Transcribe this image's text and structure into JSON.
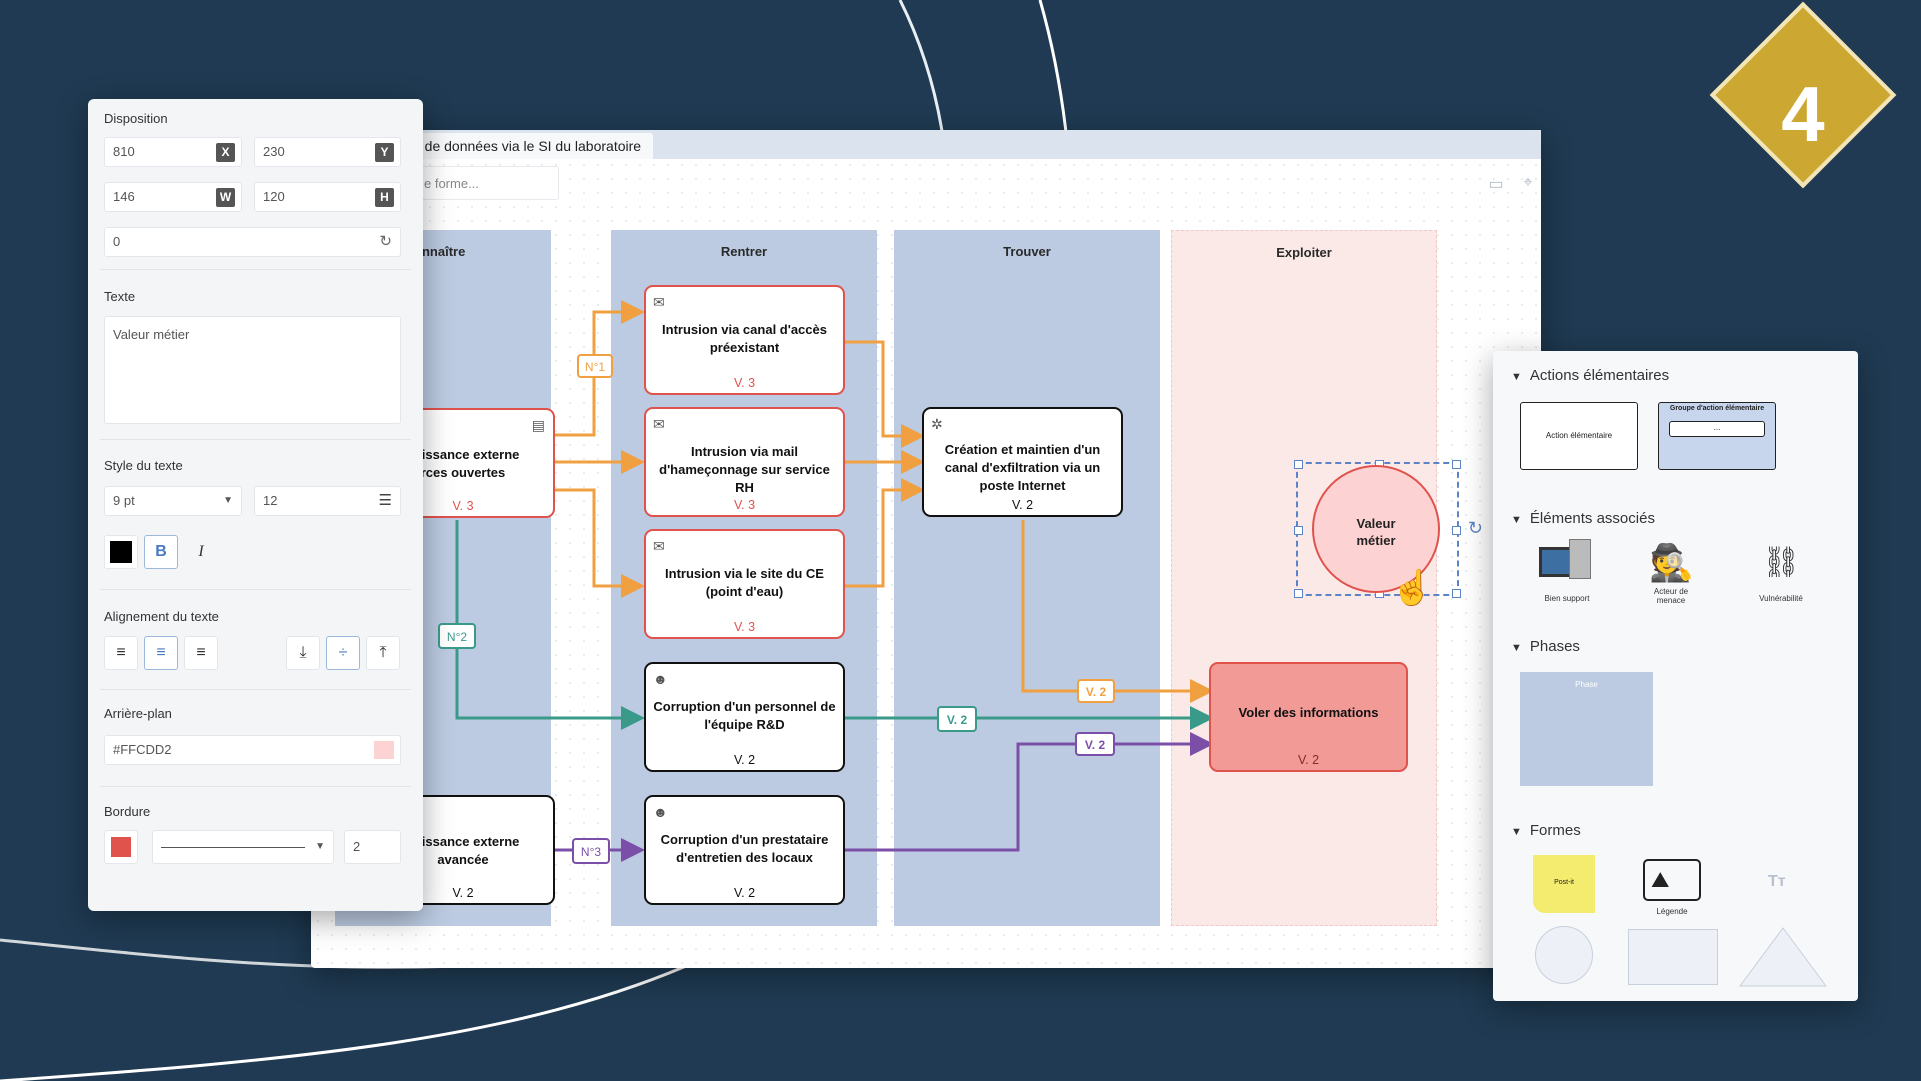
{
  "step_badge": "4",
  "tab": {
    "title": "n de données via le SI du laboratoire"
  },
  "search": {
    "placeholder": "e forme..."
  },
  "phases": [
    {
      "label": "Connaître"
    },
    {
      "label": "Rentrer"
    },
    {
      "label": "Trouver"
    },
    {
      "label": "Exploiter"
    }
  ],
  "nodes": {
    "n1": {
      "label": "naissance externe\nrces ouvertes",
      "version": "V. 3"
    },
    "n2": {
      "label": "naissance externe\navancée",
      "version": "V. 2"
    },
    "r1": {
      "label": "Intrusion via canal d'accès préexistant",
      "version": "V. 3"
    },
    "r2": {
      "label": "Intrusion via mail d'hameçonnage sur service RH",
      "version": "V. 3"
    },
    "r3": {
      "label": "Intrusion via le site du CE (point d'eau)",
      "version": "V. 3"
    },
    "r4": {
      "label": "Corruption d'un personnel de l'équipe R&D",
      "version": "V. 2"
    },
    "r5": {
      "label": "Corruption d'un prestataire d'entretien des locaux",
      "version": "V. 2"
    },
    "t1": {
      "label": "Création et maintien d'un canal d'exfiltration via un poste Internet",
      "version": "V. 2"
    },
    "e1": {
      "label": "Voler des informations",
      "version": "V. 2"
    },
    "valeur": {
      "label": "Valeur\nmétier"
    }
  },
  "links": {
    "n1_label": "N°1",
    "n2_label": "N°2",
    "n3_label": "N°3",
    "v2_a": "V. 2",
    "v2_b": "V. 2",
    "v2_c": "V. 2"
  },
  "colors": {
    "orange": "#f0a040",
    "teal": "#3a9a8a",
    "purple": "#7b4fa8",
    "red": "#e0524c",
    "phase_blue": "#bccbe2",
    "phase_pink": "#fbe9e8",
    "goal_fill": "#f19a96",
    "valeur_fill": "#fdd2d2"
  },
  "props": {
    "disposition_title": "Disposition",
    "x": "810",
    "x_suffix": "X",
    "y": "230",
    "y_suffix": "Y",
    "w": "146",
    "w_suffix": "W",
    "h": "120",
    "h_suffix": "H",
    "rotation": "0",
    "texte_title": "Texte",
    "texte_value": "Valeur métier",
    "style_title": "Style du texte",
    "font_size": "9 pt",
    "line_height": "12",
    "bold": "B",
    "italic": "I",
    "align_title": "Alignement du texte",
    "bg_title": "Arrière-plan",
    "bg_value": "#FFCDD2",
    "border_title": "Bordure",
    "border_width": "2",
    "text_color": "#000000",
    "border_color": "#e0524c"
  },
  "library": {
    "sec1": "Actions élémentaires",
    "item_action": "Action élémentaire",
    "item_group": "Groupe d'action élémentaire",
    "item_group_inner": "...",
    "sec2": "Éléments associés",
    "item_bien": "Bien support",
    "item_acteur": "Acteur de menace",
    "item_vuln": "Vulnérabilité",
    "sec3": "Phases",
    "item_phase": "Phase",
    "sec4": "Formes",
    "item_postit": "Post-it",
    "item_legende": "Légende",
    "item_text": "Tт"
  }
}
